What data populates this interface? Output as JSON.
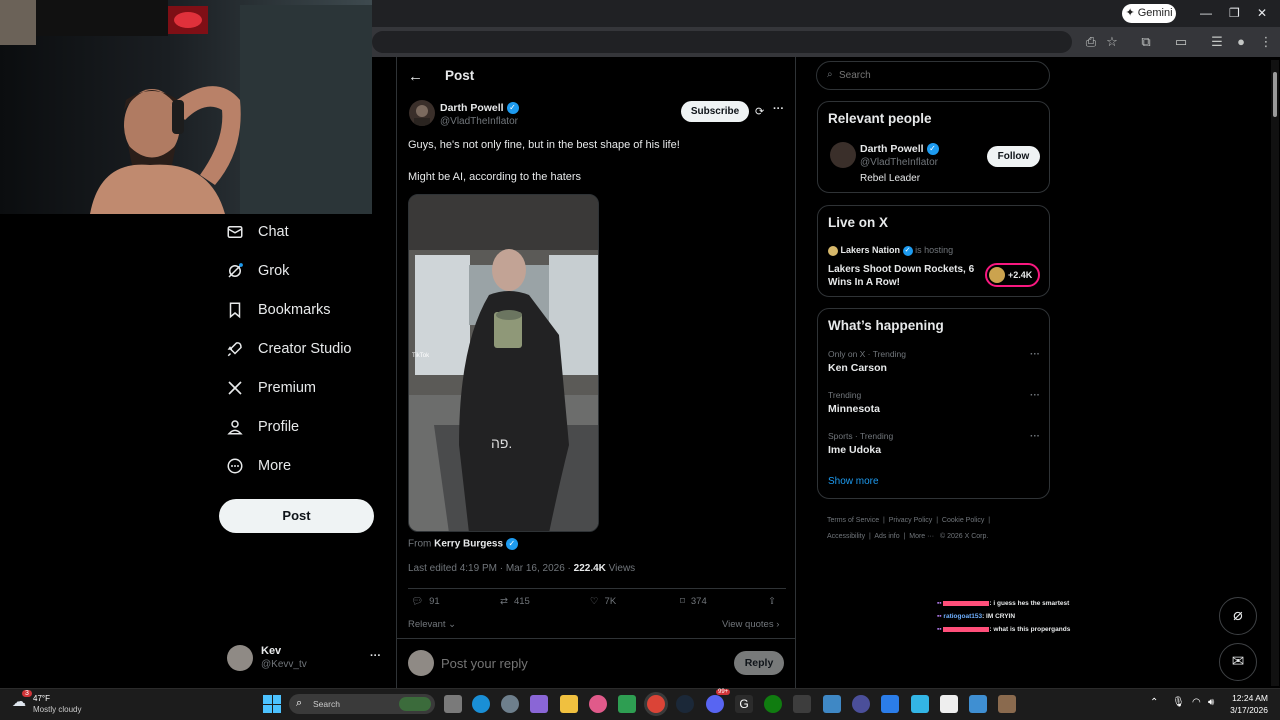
{
  "browser": {
    "gemini_label": "Gemini"
  },
  "header": {
    "title": "Post"
  },
  "nav": [
    {
      "label": "Chat",
      "icon": "mail-icon"
    },
    {
      "label": "Grok",
      "icon": "grok-icon"
    },
    {
      "label": "Bookmarks",
      "icon": "bookmark-icon"
    },
    {
      "label": "Creator Studio",
      "icon": "rocket-icon"
    },
    {
      "label": "Premium",
      "icon": "x-logo-icon"
    },
    {
      "label": "Profile",
      "icon": "person-icon"
    },
    {
      "label": "More",
      "icon": "more-circle-icon"
    }
  ],
  "post_button": "Post",
  "account": {
    "name": "Kev",
    "handle": "@Kevv_tv"
  },
  "tweet": {
    "author": "Darth Powell",
    "handle": "@VladTheInflator",
    "subscribe": "Subscribe",
    "line1": "Guys, he's not only fine, but in the best shape of his life!",
    "line2": "Might be AI, according to the haters",
    "video_overlay_text": "פה.",
    "tiktok_label": "TikTok",
    "from_label": "From",
    "from_name": "Kerry Burgess",
    "edited": "Last edited 4:19 PM · Mar 16, 2026 · ",
    "views_count": "222.4K",
    "views_label": " Views",
    "replies": "91",
    "reposts": "415",
    "likes": "7K",
    "bookmarks": "374",
    "relevant": "Relevant",
    "view_quotes": "View quotes",
    "reply_placeholder": "Post your reply",
    "reply_button": "Reply"
  },
  "search": {
    "placeholder": "Search"
  },
  "relevant_people": {
    "title": "Relevant people",
    "name": "Darth Powell",
    "handle": "@VladTheInflator",
    "bio": "Rebel Leader",
    "follow": "Follow"
  },
  "live": {
    "title": "Live on X",
    "host": "Lakers Nation",
    "hosting": "is hosting",
    "headline": "Lakers Shoot Down Rockets, 6 Wins In A Row!",
    "count": "+2.4K"
  },
  "happening": {
    "title": "What’s happening",
    "items": [
      {
        "context": "Only on X · Trending",
        "topic": "Ken Carson"
      },
      {
        "context": "Trending",
        "topic": "Minnesota"
      },
      {
        "context": "Sports · Trending",
        "topic": "Ime Udoka"
      }
    ],
    "show_more": "Show more"
  },
  "footer": {
    "links": [
      "Terms of Service",
      "Privacy Policy",
      "Cookie Policy",
      "Accessibility",
      "Ads info",
      "More ···",
      "© 2026 X Corp."
    ]
  },
  "chat_overlay": [
    {
      "user": "",
      "msg": ": i guess hes the smartest"
    },
    {
      "user": "ratiogoat153",
      "msg": ": IM CRYIN"
    },
    {
      "user": "",
      "msg": ": what is this propergands"
    }
  ],
  "taskbar": {
    "weather_temp": "47°F",
    "weather_desc": "Mostly cloudy",
    "weather_badge": "3",
    "search_placeholder": "Search",
    "time": "12:24 AM",
    "date": "3/17/2026",
    "discord_badge": "99+"
  },
  "colors": {
    "x_blue": "#1d9bf0",
    "bg": "#000000",
    "border": "#2f3336",
    "muted": "#71767b"
  }
}
